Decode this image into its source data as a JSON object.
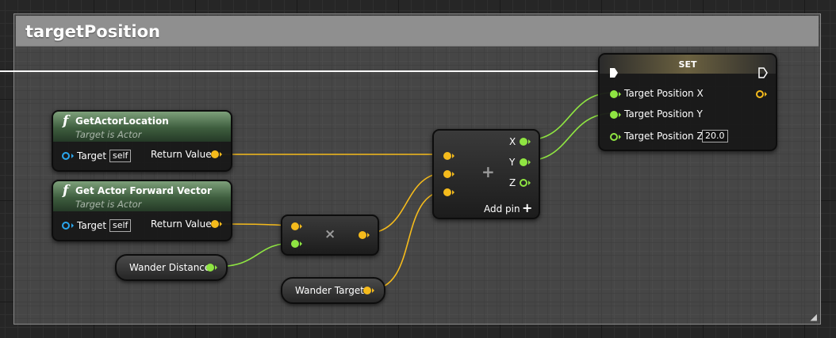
{
  "comment": {
    "title": "targetPosition"
  },
  "nodes": {
    "get_actor_location": {
      "title": "GetActorLocation",
      "subtitle": "Target is Actor",
      "target_label": "Target",
      "target_value": "self",
      "return_label": "Return Value"
    },
    "get_actor_forward_vector": {
      "title": "Get Actor Forward Vector",
      "subtitle": "Target is Actor",
      "target_label": "Target",
      "target_value": "self",
      "return_label": "Return Value"
    },
    "multiply": {
      "symbol": "×"
    },
    "add": {
      "symbol": "+",
      "x_label": "X",
      "y_label": "Y",
      "z_label": "Z",
      "add_pin_label": "Add pin",
      "add_pin_symbol": "+"
    },
    "set": {
      "title": "SET",
      "x_label": "Target Position X",
      "y_label": "Target Position Y",
      "z_label": "Target Position Z",
      "z_value": "20.0"
    },
    "wander_distance": {
      "label": "Wander Distance"
    },
    "wander_target": {
      "label": "Wander Target"
    }
  },
  "colors": {
    "vector": "#f5bb1c",
    "float": "#8fe542",
    "object": "#2aa7ee",
    "exec": "#ffffff",
    "pure_header": "#3e5d3e"
  },
  "icons": {
    "function": "f",
    "resize_grip": "◢"
  }
}
